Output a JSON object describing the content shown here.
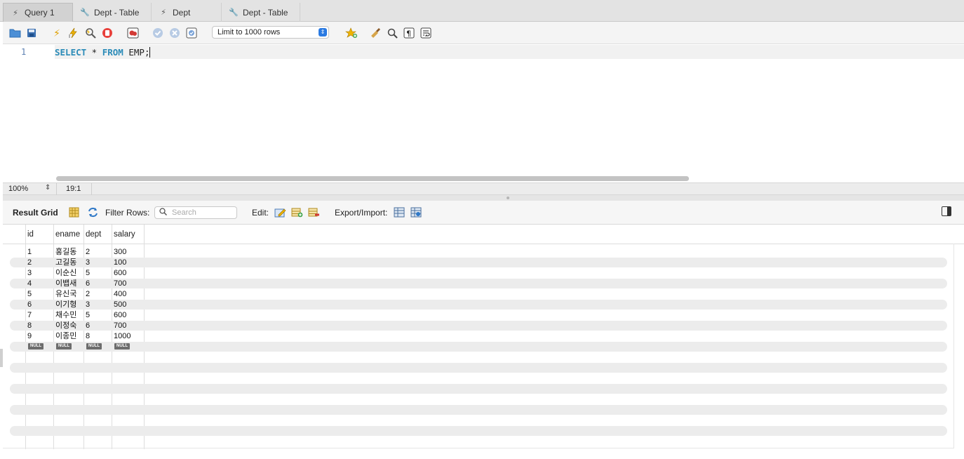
{
  "tabs": [
    {
      "label": "Query 1",
      "icon": "lightning-icon"
    },
    {
      "label": "Dept - Table",
      "icon": "wrench-icon"
    },
    {
      "label": "Dept",
      "icon": "lightning-icon"
    },
    {
      "label": "Dept - Table",
      "icon": "wrench-icon"
    }
  ],
  "toolbar": {
    "limit_select": "Limit to 1000 rows"
  },
  "editor": {
    "line_number": "1",
    "kw1": "SELECT",
    "star": " * ",
    "kw2": "FROM",
    "rest": " EMP;"
  },
  "status": {
    "zoom": "100%",
    "cursor": "19:1"
  },
  "result_toolbar": {
    "result_grid": "Result Grid",
    "filter_rows": "Filter Rows:",
    "search_placeholder": "Search",
    "edit": "Edit:",
    "export_import": "Export/Import:"
  },
  "grid": {
    "columns": [
      "id",
      "ename",
      "dept",
      "salary"
    ],
    "rows": [
      [
        "1",
        "홍길동",
        "2",
        "300"
      ],
      [
        "2",
        "고길동",
        "3",
        "100"
      ],
      [
        "3",
        "이순신",
        "5",
        "600"
      ],
      [
        "4",
        "이뱁새",
        "6",
        "700"
      ],
      [
        "5",
        "유신국",
        "2",
        "400"
      ],
      [
        "6",
        "이기형",
        "3",
        "500"
      ],
      [
        "7",
        "채수민",
        "5",
        "600"
      ],
      [
        "8",
        "이정숙",
        "6",
        "700"
      ],
      [
        "9",
        "이종민",
        "8",
        "1000"
      ]
    ],
    "null_label": "NULL"
  },
  "colors": {
    "keyword": "#2a8bb8",
    "row_alt": "#ececec",
    "accent": "#2a7ae2"
  }
}
